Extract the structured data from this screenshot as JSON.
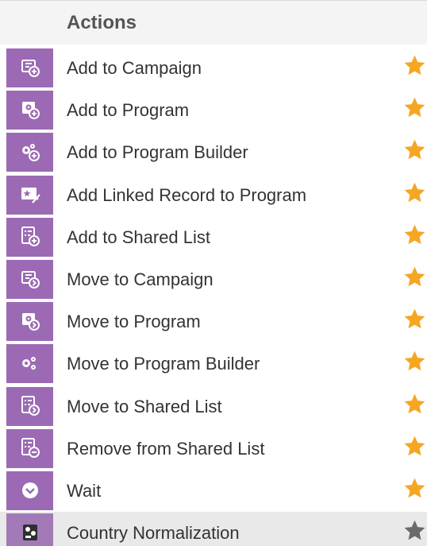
{
  "header": {
    "title": "Actions"
  },
  "items": [
    {
      "label": "Add to Campaign",
      "icon": "campaign-add-icon",
      "favorite": true
    },
    {
      "label": "Add to Program",
      "icon": "program-add-icon",
      "favorite": true
    },
    {
      "label": "Add to Program Builder",
      "icon": "program-builder-add-icon",
      "favorite": true
    },
    {
      "label": "Add Linked Record to Program",
      "icon": "linked-record-icon",
      "favorite": true
    },
    {
      "label": "Add to Shared List",
      "icon": "shared-list-add-icon",
      "favorite": true
    },
    {
      "label": "Move to Campaign",
      "icon": "campaign-move-icon",
      "favorite": true
    },
    {
      "label": "Move to Program",
      "icon": "program-move-icon",
      "favorite": true
    },
    {
      "label": "Move to Program Builder",
      "icon": "program-builder-move-icon",
      "favorite": true
    },
    {
      "label": "Move to Shared List",
      "icon": "shared-list-move-icon",
      "favorite": true
    },
    {
      "label": "Remove from Shared List",
      "icon": "shared-list-remove-icon",
      "favorite": true
    },
    {
      "label": "Wait",
      "icon": "wait-icon",
      "favorite": true
    },
    {
      "label": "Country Normalization",
      "icon": "country-normalization-icon",
      "favorite": false
    }
  ],
  "colors": {
    "tile": "#9c6ab4",
    "star_active": "#f5a623",
    "star_inactive": "#6a6a6a",
    "row_highlight": "#e9e9e9"
  }
}
